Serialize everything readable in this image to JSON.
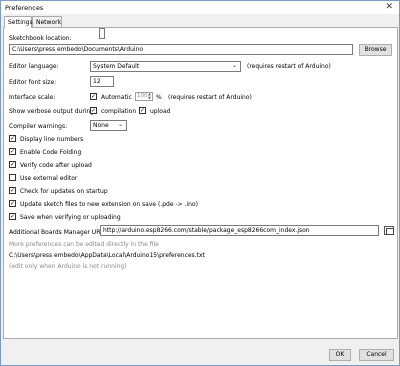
{
  "window": {
    "title": "Preferences"
  },
  "tabs": [
    {
      "label": "Settings"
    },
    {
      "label": "Network"
    }
  ],
  "sketchbook": {
    "label": "Sketchbook location:",
    "path": "C:\\Users\\press embedo\\Documents\\Arduino",
    "browse": "Browse"
  },
  "language": {
    "label": "Editor language:",
    "value": "System Default",
    "note": "(requires restart of Arduino)"
  },
  "font_size": {
    "label": "Editor font size:",
    "value": "12"
  },
  "scale": {
    "label": "Interface scale:",
    "automatic": "Automatic",
    "value": "100",
    "unit": "%",
    "note": "(requires restart of Arduino)"
  },
  "verbose": {
    "label": "Show verbose output during:",
    "compilation": "compilation",
    "upload": "upload"
  },
  "warnings": {
    "label": "Compiler warnings:",
    "value": "None"
  },
  "options": [
    {
      "label": "Display line numbers",
      "checked": true
    },
    {
      "label": "Enable Code Folding",
      "checked": true
    },
    {
      "label": "Verify code after upload",
      "checked": true
    },
    {
      "label": "Use external editor",
      "checked": false
    },
    {
      "label": "Check for updates on startup",
      "checked": true
    },
    {
      "label": "Update sketch files to new extension on save (.pde -> .ino)",
      "checked": true
    },
    {
      "label": "Save when verifying or uploading",
      "checked": true
    }
  ],
  "boards": {
    "label": "Additional Boards Manager URLs:",
    "value": "http://arduino.esp8266.com/stable/package_esp8266com_index.json"
  },
  "more": {
    "hint": "More preferences can be edited directly in the file",
    "path": "C:\\Users\\press embedo\\AppData\\Local\\Arduino15\\preferences.txt",
    "note": "(edit only when Arduino is not running)"
  },
  "footer": {
    "ok": "OK",
    "cancel": "Cancel"
  }
}
